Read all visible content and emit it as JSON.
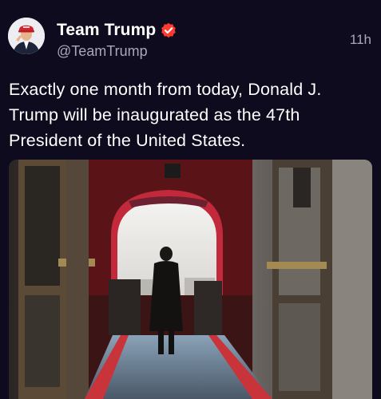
{
  "post": {
    "author": {
      "display_name": "Team Trump",
      "handle": "@TeamTrump",
      "verified": true,
      "avatar_icon": "profile-photo"
    },
    "timestamp": "11h",
    "text": "Exactly one month from today, Donald J. Trump will be inaugurated as the 47th President of the United States.",
    "media": {
      "type": "photo"
    }
  },
  "colors": {
    "background": "#0e0b1e",
    "text_primary": "#ffffff",
    "text_secondary": "#a9a6bd",
    "verified_badge": "#ff3b30"
  }
}
